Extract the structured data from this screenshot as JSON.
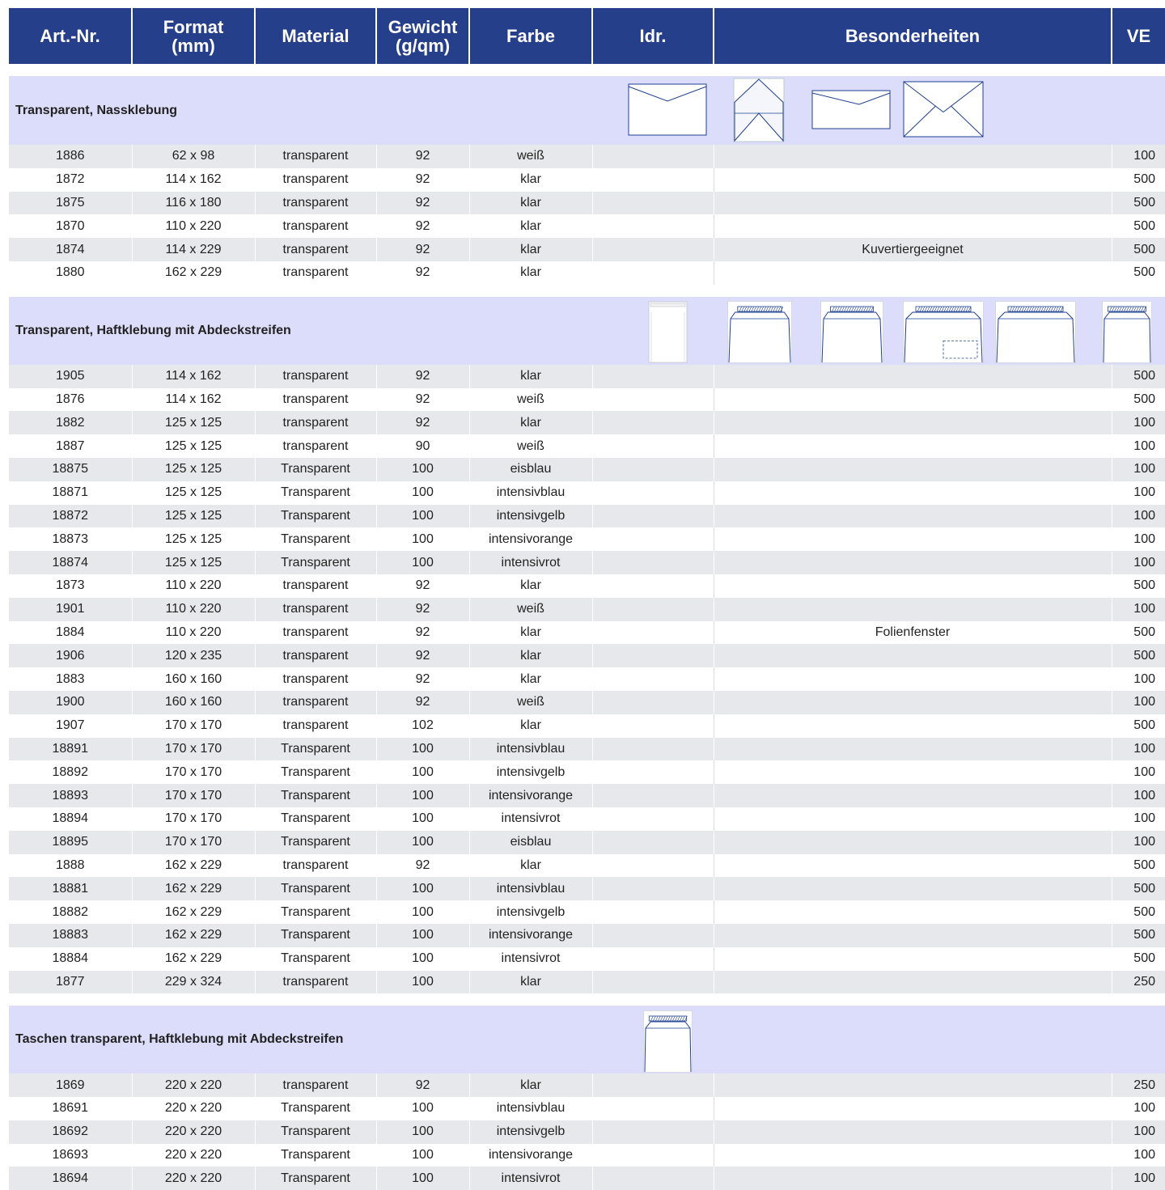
{
  "header": {
    "art_nr": "Art.-Nr.",
    "format_line1": "Format",
    "format_line2": "(mm)",
    "material": "Material",
    "gewicht_line1": "Gewicht",
    "gewicht_line2": "(g/qm)",
    "farbe": "Farbe",
    "idr": "Idr.",
    "besonderheiten": "Besonderheiten",
    "ve": "VE"
  },
  "colors": {
    "header_bg": "#263f8b",
    "section_bg": "#dcddfa",
    "row_shaded": "#e7e8eb",
    "icon_stroke": "#1e3f91"
  },
  "sections": [
    {
      "title": "Transparent, Nassklebung",
      "icons": [
        "envelope-flap-closed-icon",
        "envelope-diamond-flap-open-icon",
        "envelope-long-flap-icon",
        "envelope-cross-flap-icon"
      ],
      "rows": [
        {
          "art": "1886",
          "format": "62 x 98",
          "material": "transparent",
          "gewicht": "92",
          "farbe": "weiß",
          "idr": "",
          "besonderheiten": "",
          "ve": "100"
        },
        {
          "art": "1872",
          "format": "114 x 162",
          "material": "transparent",
          "gewicht": "92",
          "farbe": "klar",
          "idr": "",
          "besonderheiten": "",
          "ve": "500"
        },
        {
          "art": "1875",
          "format": "116 x 180",
          "material": "transparent",
          "gewicht": "92",
          "farbe": "klar",
          "idr": "",
          "besonderheiten": "",
          "ve": "500"
        },
        {
          "art": "1870",
          "format": "110 x 220",
          "material": "transparent",
          "gewicht": "92",
          "farbe": "klar",
          "idr": "",
          "besonderheiten": "",
          "ve": "500"
        },
        {
          "art": "1874",
          "format": "114 x 229",
          "material": "transparent",
          "gewicht": "92",
          "farbe": "klar",
          "idr": "",
          "besonderheiten": "Kuvertiergeeignet",
          "ve": "500"
        },
        {
          "art": "1880",
          "format": "162 x 229",
          "material": "transparent",
          "gewicht": "92",
          "farbe": "klar",
          "idr": "",
          "besonderheiten": "",
          "ve": "500"
        }
      ]
    },
    {
      "title": "Transparent, Haftklebung mit Abdeckstreifen",
      "icons": [
        "pocket-envelope-icon",
        "envelope-peel-strip-icon",
        "envelope-peel-strip-icon",
        "envelope-peel-strip-window-icon",
        "envelope-peel-strip-icon",
        "pocket-envelope-peel-strip-icon"
      ],
      "rows": [
        {
          "art": "1905",
          "format": "114 x 162",
          "material": "transparent",
          "gewicht": "92",
          "farbe": "klar",
          "idr": "",
          "besonderheiten": "",
          "ve": "500"
        },
        {
          "art": "1876",
          "format": "114 x 162",
          "material": "transparent",
          "gewicht": "92",
          "farbe": "weiß",
          "idr": "",
          "besonderheiten": "",
          "ve": "500"
        },
        {
          "art": "1882",
          "format": "125 x 125",
          "material": "transparent",
          "gewicht": "92",
          "farbe": "klar",
          "idr": "",
          "besonderheiten": "",
          "ve": "100"
        },
        {
          "art": "1887",
          "format": "125 x 125",
          "material": "transparent",
          "gewicht": "90",
          "farbe": "weiß",
          "idr": "",
          "besonderheiten": "",
          "ve": "100"
        },
        {
          "art": "18875",
          "format": "125 x 125",
          "material": "Transparent",
          "gewicht": "100",
          "farbe": "eisblau",
          "idr": "",
          "besonderheiten": "",
          "ve": "100"
        },
        {
          "art": "18871",
          "format": "125 x 125",
          "material": "Transparent",
          "gewicht": "100",
          "farbe": "intensivblau",
          "idr": "",
          "besonderheiten": "",
          "ve": "100"
        },
        {
          "art": "18872",
          "format": "125 x 125",
          "material": "Transparent",
          "gewicht": "100",
          "farbe": "intensivgelb",
          "idr": "",
          "besonderheiten": "",
          "ve": "100"
        },
        {
          "art": "18873",
          "format": "125 x 125",
          "material": "Transparent",
          "gewicht": "100",
          "farbe": "intensivorange",
          "idr": "",
          "besonderheiten": "",
          "ve": "100"
        },
        {
          "art": "18874",
          "format": "125 x 125",
          "material": "Transparent",
          "gewicht": "100",
          "farbe": "intensivrot",
          "idr": "",
          "besonderheiten": "",
          "ve": "100"
        },
        {
          "art": "1873",
          "format": "110 x 220",
          "material": "transparent",
          "gewicht": "92",
          "farbe": "klar",
          "idr": "",
          "besonderheiten": "",
          "ve": "500"
        },
        {
          "art": "1901",
          "format": "110 x 220",
          "material": "transparent",
          "gewicht": "92",
          "farbe": "weiß",
          "idr": "",
          "besonderheiten": "",
          "ve": "100"
        },
        {
          "art": "1884",
          "format": "110 x 220",
          "material": "transparent",
          "gewicht": "92",
          "farbe": "klar",
          "idr": "",
          "besonderheiten": "Folienfenster",
          "ve": "500"
        },
        {
          "art": "1906",
          "format": "120 x 235",
          "material": "transparent",
          "gewicht": "92",
          "farbe": "klar",
          "idr": "",
          "besonderheiten": "",
          "ve": "500"
        },
        {
          "art": "1883",
          "format": "160 x 160",
          "material": "transparent",
          "gewicht": "92",
          "farbe": "klar",
          "idr": "",
          "besonderheiten": "",
          "ve": "100"
        },
        {
          "art": "1900",
          "format": "160 x 160",
          "material": "transparent",
          "gewicht": "92",
          "farbe": "weiß",
          "idr": "",
          "besonderheiten": "",
          "ve": "100"
        },
        {
          "art": "1907",
          "format": "170 x 170",
          "material": "transparent",
          "gewicht": "102",
          "farbe": "klar",
          "idr": "",
          "besonderheiten": "",
          "ve": "500"
        },
        {
          "art": "18891",
          "format": "170 x 170",
          "material": "Transparent",
          "gewicht": "100",
          "farbe": "intensivblau",
          "idr": "",
          "besonderheiten": "",
          "ve": "100"
        },
        {
          "art": "18892",
          "format": "170 x 170",
          "material": "Transparent",
          "gewicht": "100",
          "farbe": "intensivgelb",
          "idr": "",
          "besonderheiten": "",
          "ve": "100"
        },
        {
          "art": "18893",
          "format": "170 x 170",
          "material": "Transparent",
          "gewicht": "100",
          "farbe": "intensivorange",
          "idr": "",
          "besonderheiten": "",
          "ve": "100"
        },
        {
          "art": "18894",
          "format": "170 x 170",
          "material": "Transparent",
          "gewicht": "100",
          "farbe": "intensivrot",
          "idr": "",
          "besonderheiten": "",
          "ve": "100"
        },
        {
          "art": "18895",
          "format": "170 x 170",
          "material": "Transparent",
          "gewicht": "100",
          "farbe": "eisblau",
          "idr": "",
          "besonderheiten": "",
          "ve": "100"
        },
        {
          "art": "1888",
          "format": "162 x 229",
          "material": "transparent",
          "gewicht": "92",
          "farbe": "klar",
          "idr": "",
          "besonderheiten": "",
          "ve": "500"
        },
        {
          "art": "18881",
          "format": "162 x 229",
          "material": "Transparent",
          "gewicht": "100",
          "farbe": "intensivblau",
          "idr": "",
          "besonderheiten": "",
          "ve": "500"
        },
        {
          "art": "18882",
          "format": "162 x 229",
          "material": "Transparent",
          "gewicht": "100",
          "farbe": "intensivgelb",
          "idr": "",
          "besonderheiten": "",
          "ve": "500"
        },
        {
          "art": "18883",
          "format": "162 x 229",
          "material": "Transparent",
          "gewicht": "100",
          "farbe": "intensivorange",
          "idr": "",
          "besonderheiten": "",
          "ve": "500"
        },
        {
          "art": "18884",
          "format": "162 x 229",
          "material": "Transparent",
          "gewicht": "100",
          "farbe": "intensivrot",
          "idr": "",
          "besonderheiten": "",
          "ve": "500"
        },
        {
          "art": "1877",
          "format": "229 x 324",
          "material": "transparent",
          "gewicht": "100",
          "farbe": "klar",
          "idr": "",
          "besonderheiten": "",
          "ve": "250"
        }
      ]
    },
    {
      "title": "Taschen transparent, Haftklebung mit Abdeckstreifen",
      "icons": [
        "pocket-envelope-peel-strip-icon"
      ],
      "rows": [
        {
          "art": "1869",
          "format": "220 x 220",
          "material": "transparent",
          "gewicht": "92",
          "farbe": "klar",
          "idr": "",
          "besonderheiten": "",
          "ve": "250"
        },
        {
          "art": "18691",
          "format": "220 x 220",
          "material": "Transparent",
          "gewicht": "100",
          "farbe": "intensivblau",
          "idr": "",
          "besonderheiten": "",
          "ve": "100"
        },
        {
          "art": "18692",
          "format": "220 x 220",
          "material": "Transparent",
          "gewicht": "100",
          "farbe": "intensivgelb",
          "idr": "",
          "besonderheiten": "",
          "ve": "100"
        },
        {
          "art": "18693",
          "format": "220 x 220",
          "material": "Transparent",
          "gewicht": "100",
          "farbe": "intensivorange",
          "idr": "",
          "besonderheiten": "",
          "ve": "100"
        },
        {
          "art": "18694",
          "format": "220 x 220",
          "material": "Transparent",
          "gewicht": "100",
          "farbe": "intensivrot",
          "idr": "",
          "besonderheiten": "",
          "ve": "100"
        }
      ]
    }
  ]
}
